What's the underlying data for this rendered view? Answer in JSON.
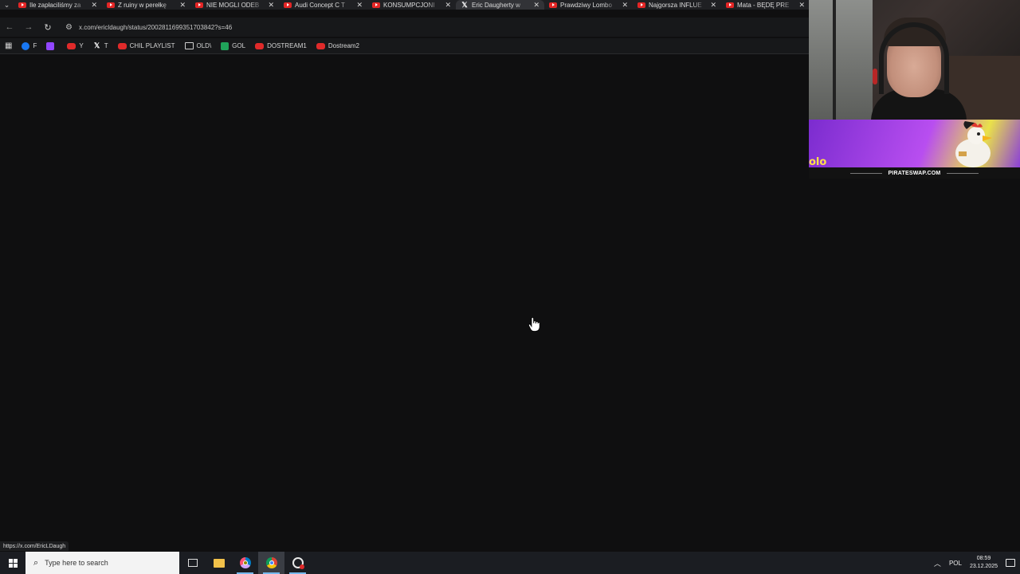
{
  "browser": {
    "tabs": [
      {
        "title": "Ile zapłaciliśmy za",
        "favicon": "youtube-icon",
        "active": false
      },
      {
        "title": "Z ruiny w perełkę",
        "favicon": "youtube-icon",
        "active": false
      },
      {
        "title": "NIE MOGLI ODEB",
        "favicon": "youtube-icon",
        "active": false
      },
      {
        "title": "Audi Concept C T",
        "favicon": "youtube-icon",
        "active": false
      },
      {
        "title": "KONSUMPCJONI",
        "favicon": "youtube-icon",
        "active": false
      },
      {
        "title": "Eric Daugherty w",
        "favicon": "x-icon",
        "active": true
      },
      {
        "title": "Prawdziwy Lombo",
        "favicon": "youtube-icon",
        "active": false
      },
      {
        "title": "Najgorsza INFLUE",
        "favicon": "youtube-icon",
        "active": false
      },
      {
        "title": "Mata - BĘDĘ PRE",
        "favicon": "youtube-icon",
        "active": false
      }
    ],
    "tab_menu_glyph": "⌄",
    "close_glyph": "✕",
    "x_glyph": "𝕏",
    "nav": {
      "back_glyph": "←",
      "forward_glyph": "→",
      "reload_glyph": "↻",
      "tune_glyph": "⚙"
    },
    "url": "x.com/ericldaugh/status/2002811699351703842?s=46",
    "bookmarks": [
      {
        "label": "F",
        "icon": "facebook-icon"
      },
      {
        "label": "",
        "icon": "twitch-icon"
      },
      {
        "label": "Y",
        "icon": "youtube-icon"
      },
      {
        "label": "T",
        "icon": "x-icon"
      },
      {
        "label": "CHIL PLAYLIST",
        "icon": "youtube-icon"
      },
      {
        "label": "OLD\\",
        "icon": "folder-icon"
      },
      {
        "label": "GOL",
        "icon": "g-icon"
      },
      {
        "label": "DOSTREAM1",
        "icon": "youtube-icon"
      },
      {
        "label": "Dostream2",
        "icon": "youtube-icon"
      }
    ],
    "apps_glyph": "▦",
    "status_url": "https://x.com/EricLDaugh"
  },
  "ad": {
    "caption": "PIRATESWAP.COM",
    "logo_fragment": "olo"
  },
  "taskbar": {
    "search_placeholder": "Type here to search",
    "search_glyph": "⌕",
    "tray_chevron": "︿",
    "language": "POL",
    "time": "08:59",
    "date": "23.12.2025"
  },
  "colors": {
    "page_bg": "#0f0f10",
    "youtube_red": "#e02a2a",
    "taskbar_bg": "#1b1d22",
    "ad_purple": "#7b2ccf"
  }
}
